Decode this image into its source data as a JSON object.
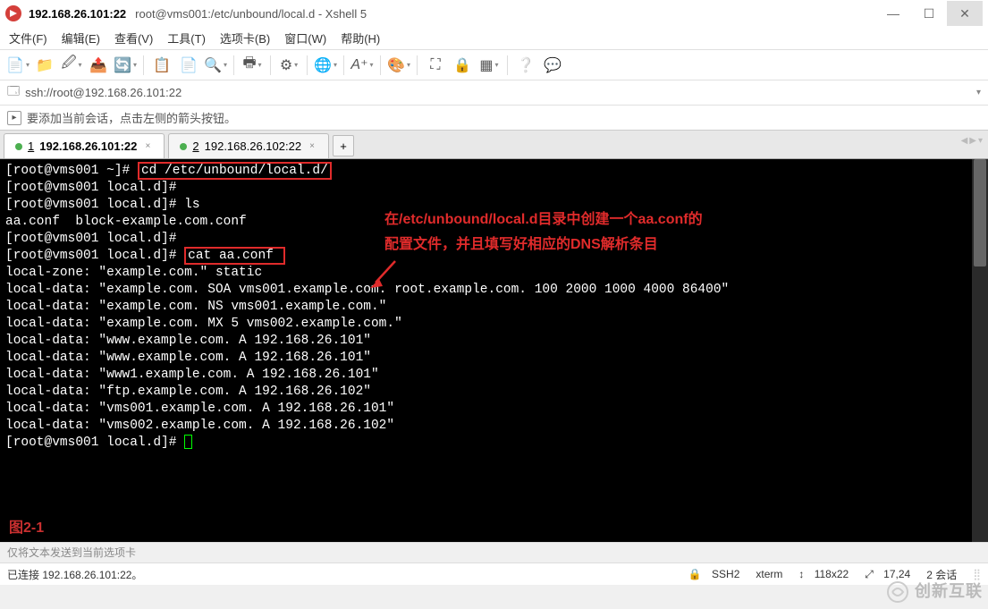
{
  "window": {
    "title_main": "192.168.26.101:22",
    "title_sub": "root@vms001:/etc/unbound/local.d - Xshell 5"
  },
  "menu": {
    "file": "文件(F)",
    "edit": "编辑(E)",
    "view": "查看(V)",
    "tools": "工具(T)",
    "tabs": "选项卡(B)",
    "window": "窗口(W)",
    "help": "帮助(H)"
  },
  "address": "ssh://root@192.168.26.101:22",
  "hint": "要添加当前会话，点击左侧的箭头按钮。",
  "tabs": [
    {
      "num": "1",
      "label": "192.168.26.101:22",
      "active": true
    },
    {
      "num": "2",
      "label": "192.168.26.102:22",
      "active": false
    }
  ],
  "terminal": {
    "lines": [
      {
        "prompt": "[root@vms001 ~]# ",
        "cmd": "cd /etc/unbound/local.d/",
        "boxed": true
      },
      {
        "prompt": "[root@vms001 local.d]#",
        "cmd": ""
      },
      {
        "prompt": "[root@vms001 local.d]# ",
        "cmd": "ls"
      },
      {
        "text": "aa.conf  block-example.com.conf"
      },
      {
        "prompt": "[root@vms001 local.d]#",
        "cmd": ""
      },
      {
        "prompt": "[root@vms001 local.d]# ",
        "cmd": "cat aa.conf ",
        "boxed": true
      },
      {
        "text": "local-zone: \"example.com.\" static"
      },
      {
        "text": "local-data: \"example.com. SOA vms001.example.com. root.example.com. 100 2000 1000 4000 86400\""
      },
      {
        "text": "local-data: \"example.com. NS vms001.example.com.\""
      },
      {
        "text": "local-data: \"example.com. MX 5 vms002.example.com.\""
      },
      {
        "text": "local-data: \"www.example.com. A 192.168.26.101\""
      },
      {
        "text": "local-data: \"www.example.com. A 192.168.26.101\""
      },
      {
        "text": "local-data: \"www1.example.com. A 192.168.26.101\""
      },
      {
        "text": "local-data: \"ftp.example.com. A 192.168.26.102\""
      },
      {
        "text": "local-data: \"vms001.example.com. A 192.168.26.101\""
      },
      {
        "text": "local-data: \"vms002.example.com. A 192.168.26.102\""
      },
      {
        "prompt": "[root@vms001 local.d]# ",
        "cursor": true
      }
    ],
    "annotation1": "在/etc/unbound/local.d目录中创建一个aa.conf的",
    "annotation2": "配置文件，并且填写好相应的DNS解析条目",
    "fig_label": "图2-1"
  },
  "sendbar": "仅将文本发送到当前选项卡",
  "status": {
    "conn": "已连接 192.168.26.101:22。",
    "proto": "SSH2",
    "term": "xterm",
    "size": "118x22",
    "pos": "17,24",
    "sess": "2 会话"
  },
  "watermark": "创新互联",
  "icons": {
    "lock": "🔒",
    "arrow_lr": "↔",
    "cross_arrows": "⤢",
    "sep": "↕"
  }
}
